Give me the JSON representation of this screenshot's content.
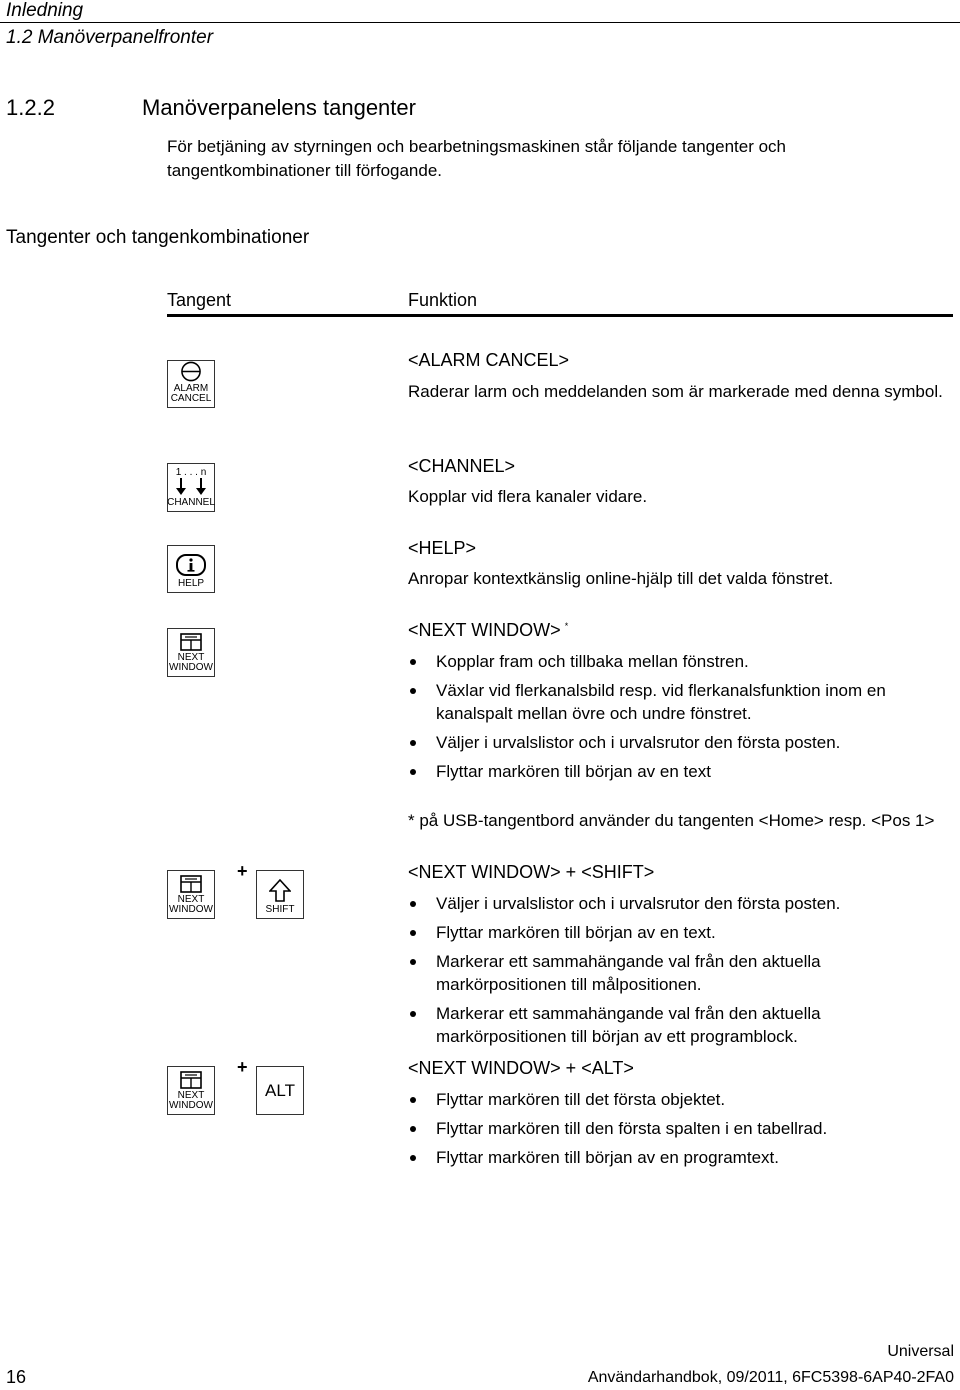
{
  "header": {
    "chapter": "Inledning",
    "section": "1.2 Manöverpanelfronter"
  },
  "section_heading": {
    "number": "1.2.2",
    "title": "Manöverpanelens tangenter"
  },
  "intro": "För betjäning av styrningen och bearbetningsmaskinen står följande tangenter och tangentkombinationer till förfogande.",
  "table": {
    "caption": "Tangenter och tangenkombinationer",
    "columns": [
      "Tangent",
      "Funktion"
    ],
    "rows": [
      {
        "keys": [
          {
            "icon": "alarm-cancel-icon",
            "label_line1": "ALARM",
            "label_line2": "CANCEL"
          }
        ],
        "title": "<ALARM CANCEL>",
        "text": "Raderar larm och meddelanden som är markerade med denna symbol."
      },
      {
        "keys": [
          {
            "icon": "channel-arrows-icon",
            "top_label": "1 . . . n",
            "label_line1": "CHANNEL"
          }
        ],
        "title": "<CHANNEL>",
        "text": "Kopplar vid flera kanaler vidare."
      },
      {
        "keys": [
          {
            "icon": "info-icon",
            "label_line1": "HELP"
          }
        ],
        "title": "<HELP>",
        "text": "Anropar kontextkänslig online-hjälp till det valda fönstret."
      },
      {
        "keys": [
          {
            "icon": "next-window-icon",
            "label_line1": "NEXT",
            "label_line2": "WINDOW"
          }
        ],
        "title": "<NEXT WINDOW>",
        "title_mark": "*",
        "bullets": [
          "Kopplar fram och tillbaka mellan fönstren.",
          "Växlar vid flerkanalsbild resp. vid flerkanalsfunktion inom en kanalspalt mellan övre och undre fönstret.",
          "Väljer i urvalslistor och i urvalsrutor den första posten.",
          "Flyttar markören till början av en text"
        ],
        "footnote": "* på USB-tangentbord använder du tangenten <Home> resp. <Pos 1>"
      },
      {
        "keys": [
          {
            "icon": "next-window-icon",
            "label_line1": "NEXT",
            "label_line2": "WINDOW"
          },
          {
            "icon": "shift-arrow-icon",
            "label_line1": "SHIFT"
          }
        ],
        "combine": "+",
        "title": "<NEXT WINDOW> + <SHIFT>",
        "bullets": [
          "Väljer i urvalslistor och i urvalsrutor den första posten.",
          "Flyttar markören till början av en text.",
          "Markerar ett sammahängande val från den aktuella markörpositionen till målpositionen.",
          "Markerar ett sammahängande val från den aktuella markörpositionen till början av ett programblock."
        ]
      },
      {
        "keys": [
          {
            "icon": "next-window-icon",
            "label_line1": "NEXT",
            "label_line2": "WINDOW"
          },
          {
            "icon": "none",
            "label_line1": "ALT"
          }
        ],
        "combine": "+",
        "title": "<NEXT WINDOW> + <ALT>",
        "bullets": [
          "Flyttar markören till det första objektet.",
          "Flyttar markören till den första spalten i en tabellrad.",
          "Flyttar markören till början av en programtext."
        ]
      }
    ]
  },
  "footer": {
    "page_number": "16",
    "product": "Universal",
    "doc_info": "Användarhandbok, 09/2011, 6FC5398-6AP40-2FA0"
  }
}
